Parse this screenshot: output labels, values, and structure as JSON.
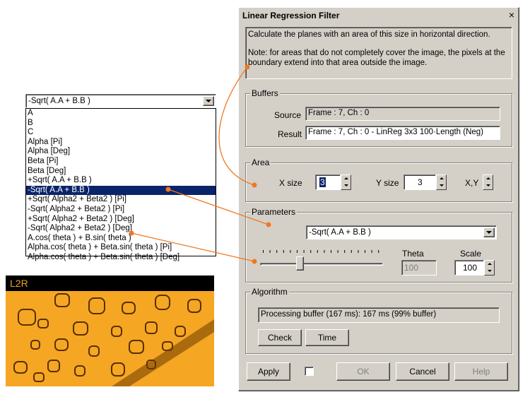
{
  "dialog": {
    "title": "Linear Regression Filter",
    "close_glyph": "×",
    "description_line1": "Calculate the planes with an area of this size in horizontal direction.",
    "description_line2": "Note: for areas that do not completely cover the image, the pixels at the boundary extend into that area outside the image.",
    "buffers": {
      "legend": "Buffers",
      "source_label": "Source",
      "source_value": "Frame : 7, Ch : 0",
      "result_label": "Result",
      "result_value": "Frame : 7, Ch : 0 - LinReg 3x3 100·Length (Neg)"
    },
    "area": {
      "legend": "Area",
      "xsize_label": "X size",
      "xsize_value": "3",
      "ysize_label": "Y size",
      "ysize_value": "3",
      "xy_label": "X,Y"
    },
    "parameters": {
      "legend": "Parameters",
      "mode_value": "-Sqrt( A.A + B.B )",
      "theta_label": "Theta",
      "theta_value": "100",
      "scale_label": "Scale",
      "scale_value": "100",
      "slider_level": 0.33
    },
    "algorithm": {
      "legend": "Algorithm",
      "status": "Processing buffer (167 ms): 167 ms (99% buffer)",
      "check_label": "Check",
      "time_label": "Time"
    },
    "footer": {
      "apply_label": "Apply",
      "ok_label": "OK",
      "cancel_label": "Cancel",
      "help_label": "Help"
    }
  },
  "dropdown": {
    "selected_value": "-Sqrt( A.A + B.B )",
    "options": [
      "A",
      "B",
      "C",
      "Alpha [Pi]",
      "Alpha [Deg]",
      "Beta [Pi]",
      "Beta [Deg]",
      "+Sqrt( A.A + B.B )",
      "-Sqrt( A.A + B.B )",
      "+Sqrt( Alpha2 + Beta2 ) [Pi]",
      "-Sqrt( Alpha2 + Beta2 ) [Pi]",
      "+Sqrt( Alpha2 + Beta2 ) [Deg]",
      "-Sqrt( Alpha2 + Beta2 ) [Deg]",
      "A.cos( theta ) + B.sin( theta )",
      "Alpha.cos( theta ) + Beta.sin( theta ) [Pi]",
      "Alpha.cos( theta ) + Beta.sin( theta ) [Deg]"
    ],
    "selected_index": 8
  },
  "image_panel": {
    "label": "L2R"
  },
  "colors": {
    "dialog_bg": "#d4d0c8",
    "titlebar": "#d4d0c8",
    "selection": "#0a246a",
    "callout": "#f07820",
    "image_orange": "#f5a623",
    "image_label": "#e8a020"
  }
}
